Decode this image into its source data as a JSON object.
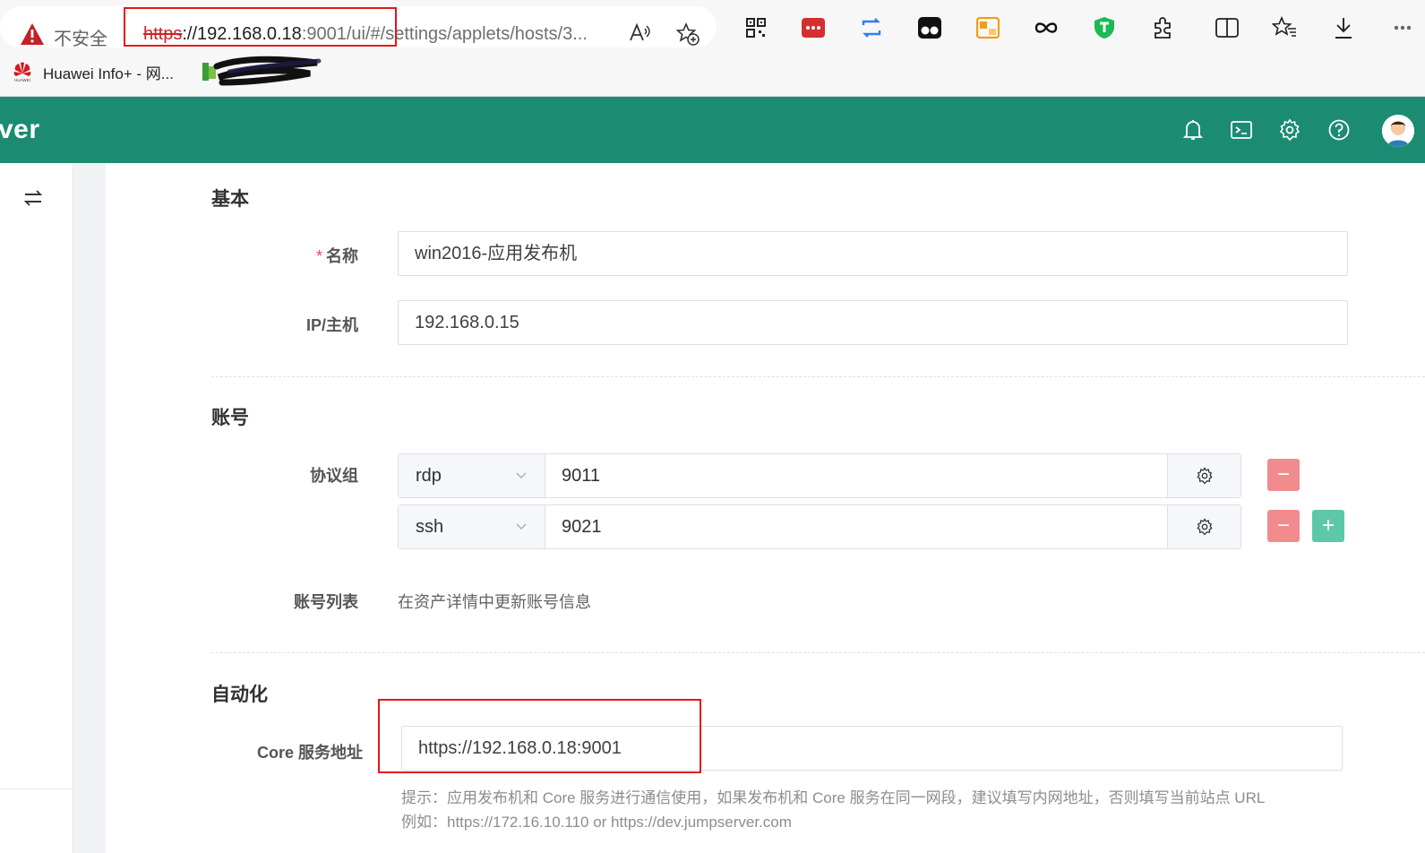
{
  "browser": {
    "insecure_label": "不安全",
    "url_protocol": "https",
    "url_host": "://192.168.0.18",
    "url_rest": ":9001/ui/#/settings/applets/hosts/3...",
    "read_aloud_label": "A",
    "bookmarks": [
      {
        "label": "Huawei Info+ - 网..."
      }
    ]
  },
  "app": {
    "brand": "ver",
    "header_icons": [
      "bell-icon",
      "terminal-icon",
      "gear-icon",
      "help-icon",
      "avatar"
    ]
  },
  "form": {
    "basic": {
      "title": "基本",
      "name_label": "名称",
      "name_required_mark": "*",
      "name_value": "win2016-应用发布机",
      "ip_label": "IP/主机",
      "ip_value": "192.168.0.15"
    },
    "account": {
      "title": "账号",
      "protocols_label": "协议组",
      "protocols": [
        {
          "name": "rdp",
          "port": "9011"
        },
        {
          "name": "ssh",
          "port": "9021"
        }
      ],
      "minus_label": "−",
      "plus_label": "+",
      "account_list_label": "账号列表",
      "account_list_value": "在资产详情中更新账号信息"
    },
    "automation": {
      "title": "自动化",
      "core_label": "Core 服务地址",
      "core_value": "https://192.168.0.18:9001",
      "hint_line1": "提示：应用发布机和 Core 服务进行通信使用，如果发布机和 Core 服务在同一网段，建议填写内网地址，否则填写当前站点 URL",
      "hint_line2": "例如：https://172.16.10.110 or https://dev.jumpserver.com"
    }
  },
  "colors": {
    "header_green": "#1b8c72",
    "highlight_red": "#e5151a",
    "minus_red": "#f28b8e",
    "plus_green": "#5cc8a7"
  }
}
